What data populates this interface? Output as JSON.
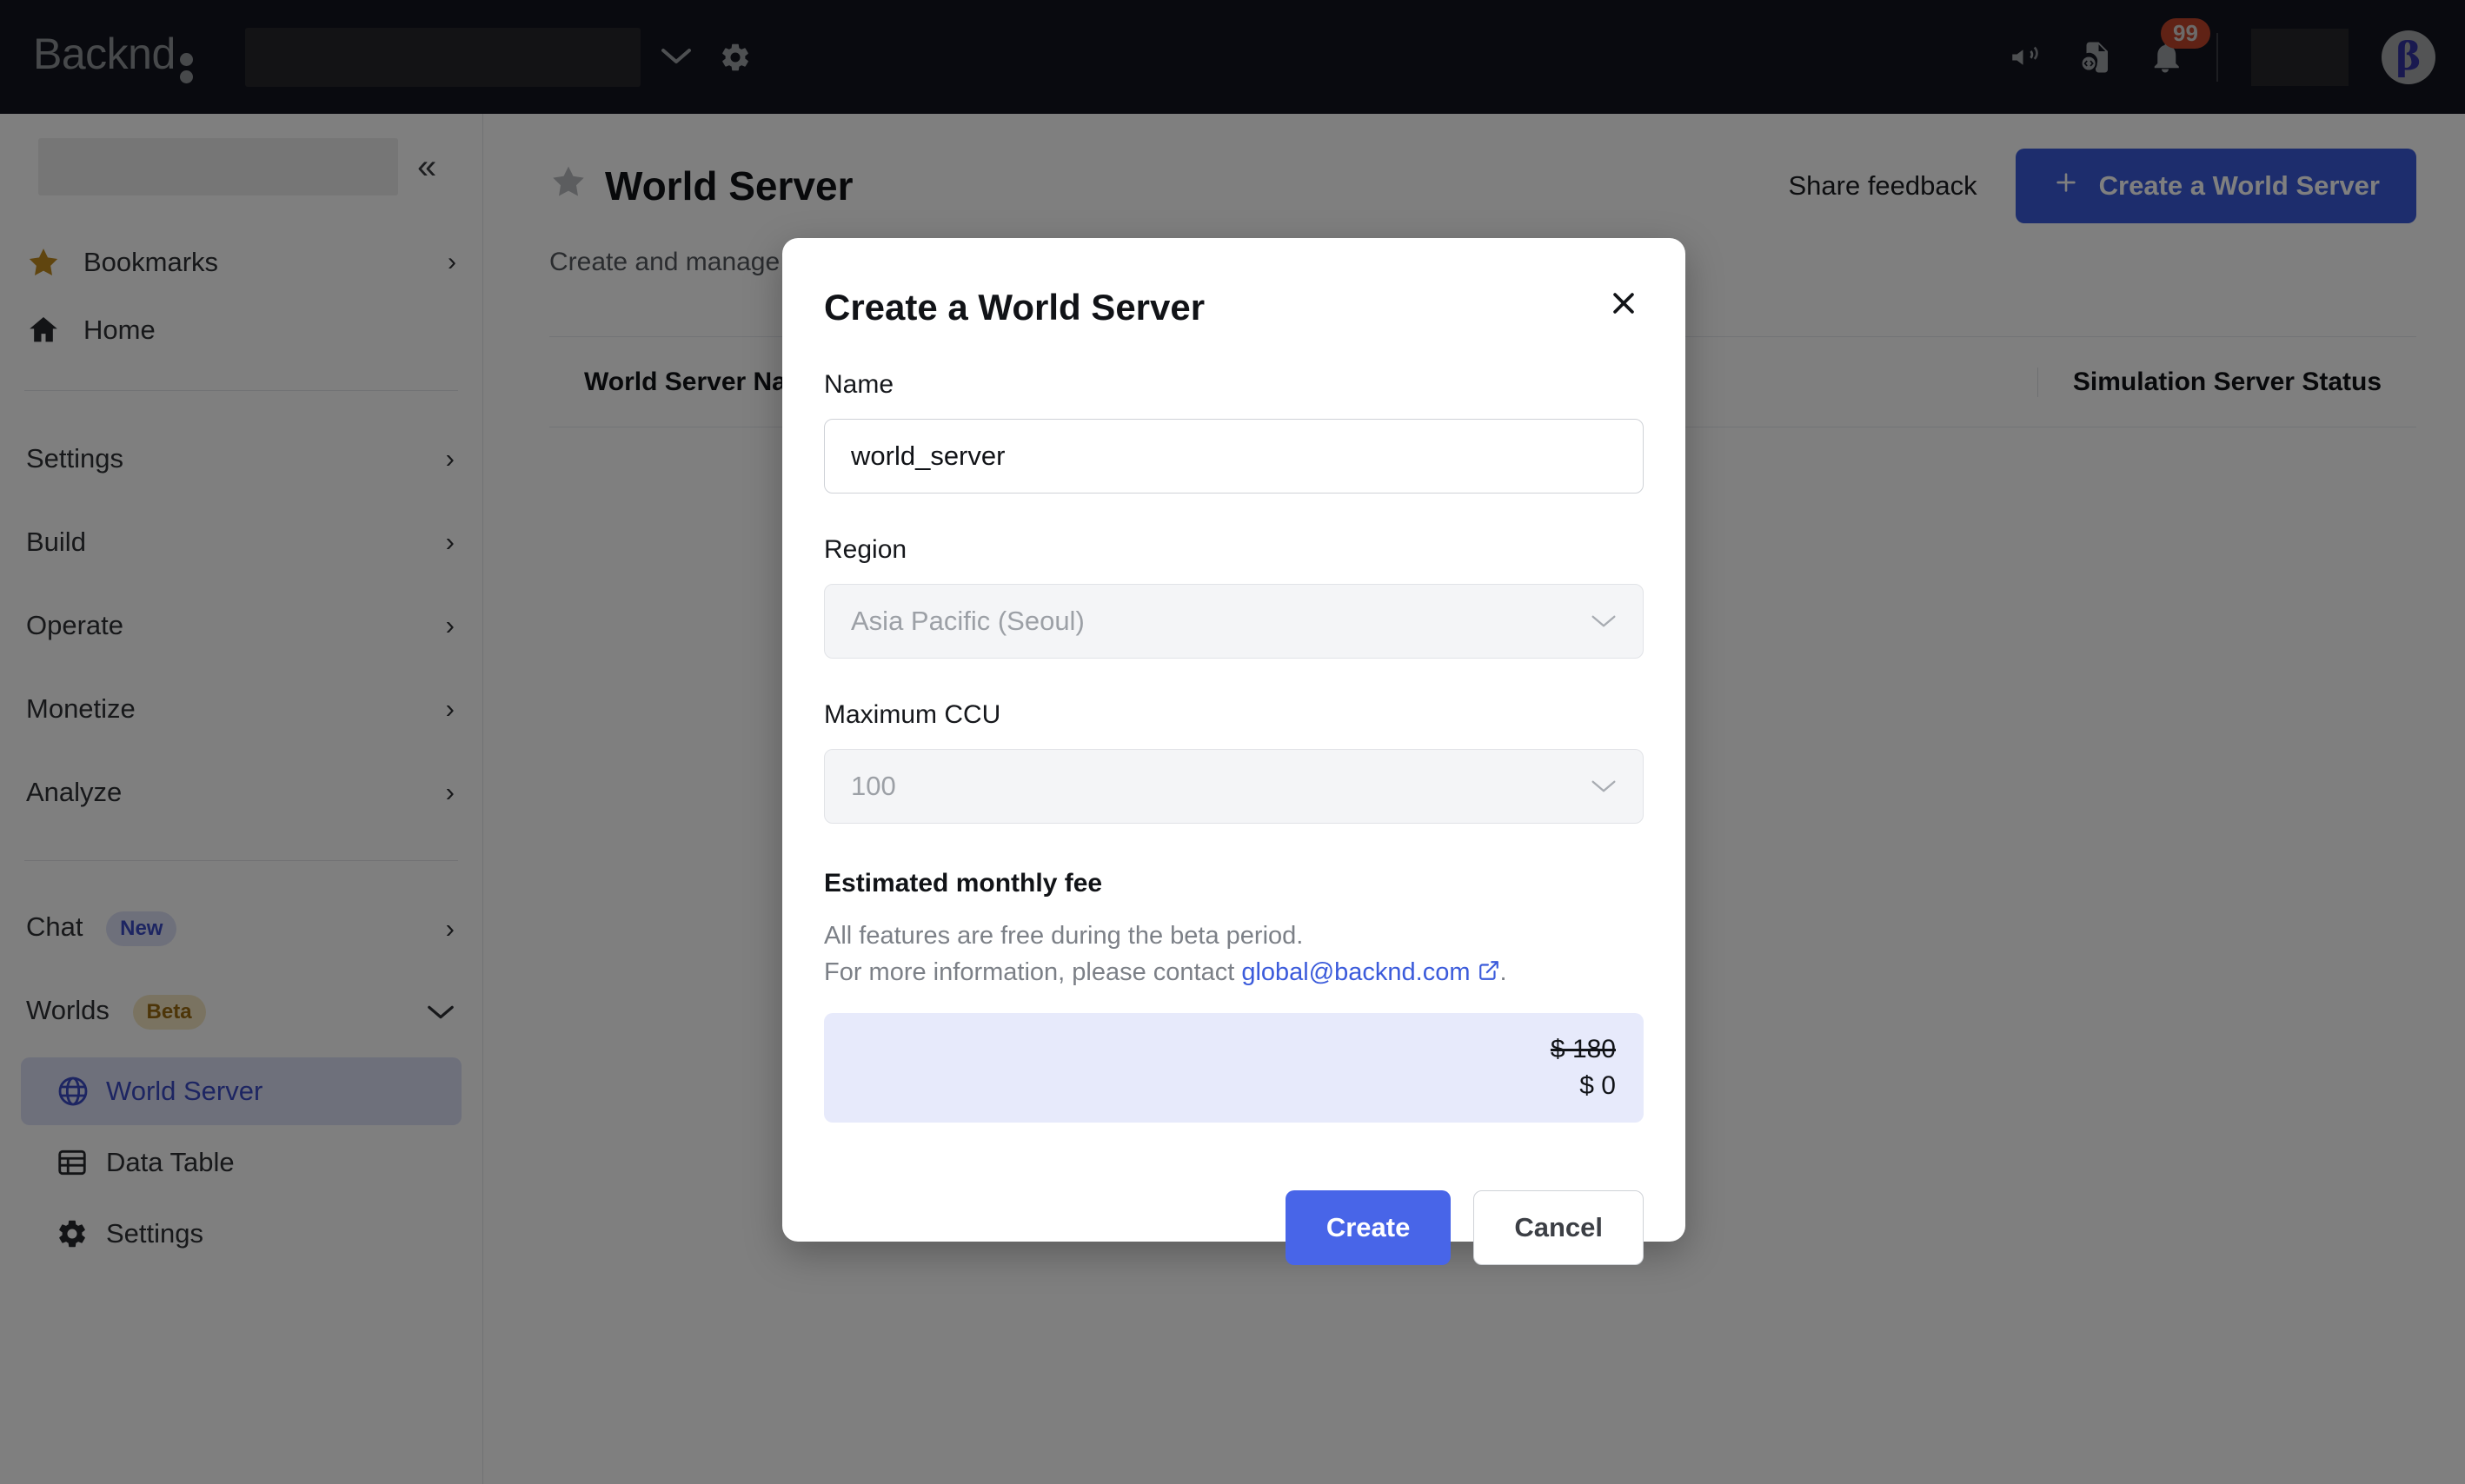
{
  "topbar": {
    "brand": "Backnd",
    "project_select_placeholder": "",
    "chevron_icon": "chevron-down-icon",
    "gear_icon": "gear-icon",
    "announce_icon": "megaphone-icon",
    "docs_icon": "code-file-icon",
    "bell_icon": "bell-icon",
    "notification_count": "99",
    "avatar_initial": "β"
  },
  "sidebar": {
    "collapse_label": "«",
    "top_items": [
      {
        "label": "Bookmarks",
        "icon": "star-icon",
        "chevron": "›"
      },
      {
        "label": "Home",
        "icon": "home-icon",
        "chevron": ""
      }
    ],
    "sections": [
      {
        "label": "Settings",
        "chevron": "›"
      },
      {
        "label": "Build",
        "chevron": "›"
      },
      {
        "label": "Operate",
        "chevron": "›"
      },
      {
        "label": "Monetize",
        "chevron": "›"
      },
      {
        "label": "Analyze",
        "chevron": "›"
      }
    ],
    "chat": {
      "label": "Chat",
      "tag": "New",
      "chevron": "›"
    },
    "worlds": {
      "label": "Worlds",
      "tag": "Beta",
      "chevron": "⌄"
    },
    "worlds_items": [
      {
        "label": "World Server",
        "icon": "globe-icon",
        "active": true
      },
      {
        "label": "Data Table",
        "icon": "table-icon",
        "active": false
      },
      {
        "label": "Settings",
        "icon": "gear-icon",
        "active": false
      }
    ]
  },
  "page": {
    "star_icon": "star-outline-icon",
    "title": "World Server",
    "subtitle": "Create and manage w",
    "share_feedback": "Share feedback",
    "create_button": "Create a World Server",
    "create_button_icon": "plus-icon",
    "table_headers": [
      "World Server Nam",
      "Simulation Server Status"
    ]
  },
  "modal": {
    "title": "Create a World Server",
    "close_icon": "close-icon",
    "name_label": "Name",
    "name_value": "world_server",
    "region_label": "Region",
    "region_value": "Asia Pacific (Seoul)",
    "ccu_label": "Maximum CCU",
    "ccu_value": "100",
    "chevron_icon": "chevron-down-icon",
    "fee_label": "Estimated monthly fee",
    "fee_note_line1": "All features are free during the beta period.",
    "fee_note_line2_pre": "For more information, please contact ",
    "fee_contact_email": "global@backnd.com",
    "fee_note_line2_post": ".",
    "external_link_icon": "external-link-icon",
    "fee_original": "$ 180",
    "fee_discounted": "$ 0",
    "create_label": "Create",
    "cancel_label": "Cancel"
  },
  "colors": {
    "topbar_bg": "#12151f",
    "primary_blue": "#4865e8",
    "header_button_blue": "#3b5bdb",
    "badge_red": "#c0452a",
    "fee_box_bg": "#e7eafb",
    "active_nav_bg": "#dde1f7",
    "active_nav_text": "#3a4bc4",
    "beta_tag_bg": "#f4e6c2",
    "beta_tag_text": "#9a6b11"
  }
}
